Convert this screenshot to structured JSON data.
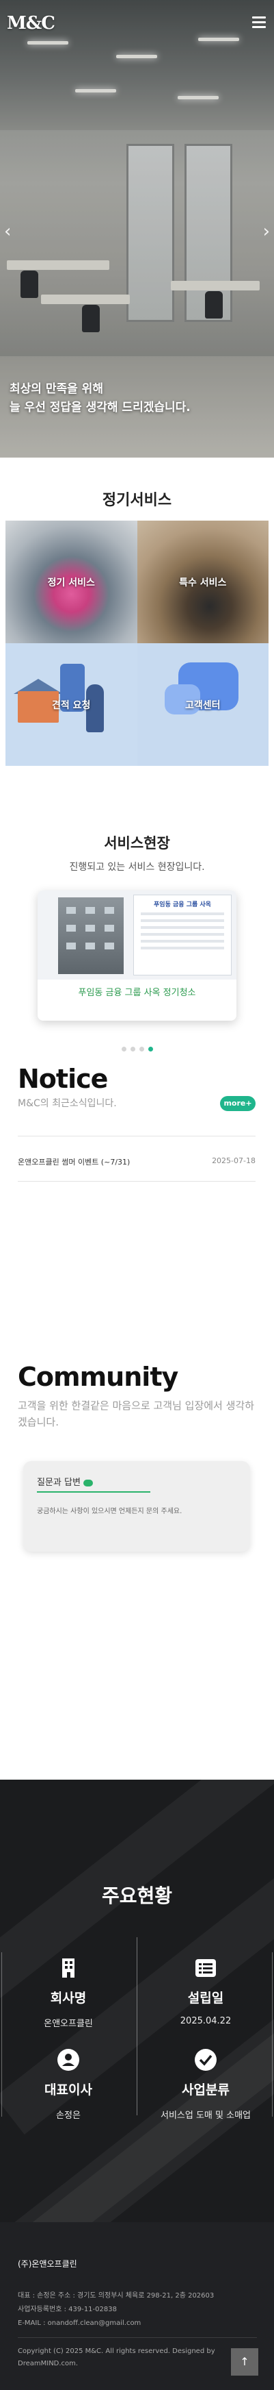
{
  "header": {
    "logo_text": "M&C",
    "menu_icon": "hamburger-menu-icon"
  },
  "hero": {
    "line1": "최상의 만족을 위해",
    "line2": "늘 우선 정답을 생각해 드리겠습니다."
  },
  "regular_services": {
    "title": "정기서비스",
    "items": [
      {
        "label": "정기 서비스"
      },
      {
        "label": "특수 서비스"
      },
      {
        "label": "견적 요청"
      },
      {
        "label": "고객센터"
      }
    ]
  },
  "service_status": {
    "title": "서비스현장",
    "subtitle": "진행되고 있는 서비스 현장입니다.",
    "card_caption": "푸임동 금융 그룹 사옥 정기청소",
    "doc_title": "푸임동 금융 그룹 사옥",
    "dots_active": 4,
    "dots_total": 4
  },
  "notice": {
    "title": "Notice",
    "subtitle": "M&C의 최근소식입니다.",
    "more_label": "more+",
    "rows": [
      {
        "title": "온앤오프클린 썸머 이벤트 (~7/31)",
        "date": "2025-07-18"
      }
    ]
  },
  "community": {
    "title": "Community",
    "subtitle": "고객을 위한 한결같은 마음으로 고객님 입장에서 생각하겠습니다.",
    "card_heading": "질문과 답변",
    "card_text": "궁금하시는 사항이 있으시면 언제든지 문의 주세요."
  },
  "company_status": {
    "title": "주요현황",
    "stats": [
      {
        "icon": "building-icon",
        "label": "회사명",
        "value": "온앤오프클린"
      },
      {
        "icon": "list-icon",
        "label": "설립일",
        "value": "2025.04.22"
      },
      {
        "icon": "person-icon",
        "label": "대표이사",
        "value": "손정은"
      },
      {
        "icon": "check-circle-icon",
        "label": "사업분류",
        "value": "서비스업 도매 및 소매업"
      }
    ]
  },
  "footer": {
    "company": "(주)온앤오프클린",
    "line1": "대표 : 손정은    주소 : 경기도 의정부시 체육로 298-21, 2층 202603",
    "line2": "사업자등록번호 : 439-11-02838",
    "line3": "E-MAIL : onandoff.clean@gmail.com",
    "copyright": "Copyright (C) 2025 M&C. All rights reserved. Designed by DreamMIND.com.",
    "top_label": "↑"
  }
}
